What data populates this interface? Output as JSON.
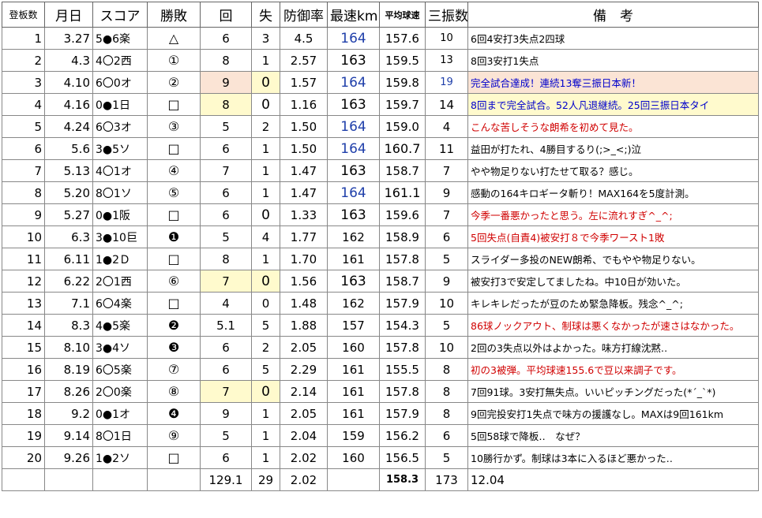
{
  "header": {
    "order": "登板数",
    "date": "月日",
    "score": "スコア",
    "result": "勝敗",
    "innings": "回",
    "runs": "失",
    "era": "防御率",
    "max_speed": "最速km",
    "avg_speed": "平均球速",
    "strikeouts": "三振数",
    "notes": "備　考"
  },
  "rows": [
    {
      "n": "1",
      "date": "3.27",
      "score": "5●6楽",
      "res": "△",
      "ip": "6",
      "r": "3",
      "era": "4.5",
      "max": "164",
      "avg": "157.6",
      "k": "10",
      "note": "6回4安打3失点2四球"
    },
    {
      "n": "2",
      "date": "4.3",
      "score": "4〇2西",
      "res": "①",
      "ip": "8",
      "r": "1",
      "era": "2.57",
      "max": "163",
      "avg": "159.5",
      "k": "13",
      "note": "8回3安打1失点"
    },
    {
      "n": "3",
      "date": "4.10",
      "score": "6〇0オ",
      "res": "②",
      "ip": "9",
      "r": "0",
      "era": "1.57",
      "max": "164",
      "avg": "159.8",
      "k": "19",
      "note": "完全試合達成！連続13奪三振日本新！"
    },
    {
      "n": "4",
      "date": "4.16",
      "score": "0●1日",
      "res": "□",
      "ip": "8",
      "r": "0",
      "era": "1.16",
      "max": "163",
      "avg": "159.7",
      "k": "14",
      "note": "8回まで完全試合。52人凡退継続。25回三振日本タイ"
    },
    {
      "n": "5",
      "date": "4.24",
      "score": "6〇3オ",
      "res": "③",
      "ip": "5",
      "r": "2",
      "era": "1.50",
      "max": "164",
      "avg": "159.0",
      "k": "4",
      "note": "こんな苦しそうな朗希を初めて見た。"
    },
    {
      "n": "6",
      "date": "5.6",
      "score": "3●5ソ",
      "res": "□",
      "ip": "6",
      "r": "1",
      "era": "1.50",
      "max": "164",
      "avg": "160.7",
      "k": "11",
      "note": "益田が打たれ、4勝目するり(;>_<;)泣"
    },
    {
      "n": "7",
      "date": "5.13",
      "score": "4〇1オ",
      "res": "④",
      "ip": "7",
      "r": "1",
      "era": "1.47",
      "max": "163",
      "avg": "158.7",
      "k": "7",
      "note": "やや物足りない打たせて取る？感じ。"
    },
    {
      "n": "8",
      "date": "5.20",
      "score": "8〇1ソ",
      "res": "⑤",
      "ip": "6",
      "r": "1",
      "era": "1.47",
      "max": "164",
      "avg": "161.1",
      "k": "9",
      "note": "感動の164キロギータ斬り！MAX164を5度計測。"
    },
    {
      "n": "9",
      "date": "5.27",
      "score": "0●1阪",
      "res": "□",
      "ip": "6",
      "r": "0",
      "era": "1.33",
      "max": "163",
      "avg": "159.6",
      "k": "7",
      "note": "今季一番悪かったと思う。左に流れすぎ^_^;"
    },
    {
      "n": "10",
      "date": "6.3",
      "score": "3●10巨",
      "res": "❶",
      "ip": "5",
      "r": "4",
      "era": "1.77",
      "max": "162",
      "avg": "158.9",
      "k": "6",
      "note": "5回失点(自責4)被安打８で今季ワースト1敗"
    },
    {
      "n": "11",
      "date": "6.11",
      "score": "1●2Ｄ",
      "res": "□",
      "ip": "8",
      "r": "1",
      "era": "1.70",
      "max": "161",
      "avg": "157.8",
      "k": "5",
      "note": "スライダー多投のNEW朗希、でもやや物足りない。"
    },
    {
      "n": "12",
      "date": "6.22",
      "score": "2〇1西",
      "res": "⑥",
      "ip": "7",
      "r": "0",
      "era": "1.56",
      "max": "163",
      "avg": "158.7",
      "k": "9",
      "note": "被安打3で安定してましたね。中10日が効いた。"
    },
    {
      "n": "13",
      "date": "7.1",
      "score": "6〇4楽",
      "res": "□",
      "ip": "4",
      "r": "0",
      "era": "1.48",
      "max": "162",
      "avg": "157.9",
      "k": "10",
      "note": "キレキレだったが豆のため緊急降板。残念^_^;"
    },
    {
      "n": "14",
      "date": "8.3",
      "score": "4●5楽",
      "res": "❷",
      "ip": "5.1",
      "r": "5",
      "era": "1.88",
      "max": "157",
      "avg": "154.3",
      "k": "5",
      "note": "86球ノックアウト、制球は悪くなかったが速さはなかった。"
    },
    {
      "n": "15",
      "date": "8.10",
      "score": "3●4ソ",
      "res": "❸",
      "ip": "6",
      "r": "2",
      "era": "2.05",
      "max": "160",
      "avg": "157.8",
      "k": "10",
      "note": "2回の3失点以外はよかった。味方打線沈黙‥"
    },
    {
      "n": "16",
      "date": "8.19",
      "score": "6〇5楽",
      "res": "⑦",
      "ip": "6",
      "r": "5",
      "era": "2.29",
      "max": "161",
      "avg": "155.5",
      "k": "8",
      "note": "初の3被弾。平均球速155.6で豆以来調子です。"
    },
    {
      "n": "17",
      "date": "8.26",
      "score": "2〇0楽",
      "res": "⑧",
      "ip": "7",
      "r": "0",
      "era": "2.14",
      "max": "161",
      "avg": "157.8",
      "k": "8",
      "note": "7回91球。3安打無失点。いいピッチングだった(*´_`*)"
    },
    {
      "n": "18",
      "date": "9.2",
      "score": "0●1オ",
      "res": "❹",
      "ip": "9",
      "r": "1",
      "era": "2.05",
      "max": "161",
      "avg": "157.9",
      "k": "8",
      "note": "9回完投安打1失点で味方の援護なし。MAXは9回161km"
    },
    {
      "n": "19",
      "date": "9.14",
      "score": "8〇1日",
      "res": "⑨",
      "ip": "5",
      "r": "1",
      "era": "2.04",
      "max": "159",
      "avg": "156.2",
      "k": "6",
      "note": "5回58球で降板‥　なぜ？"
    },
    {
      "n": "20",
      "date": "9.26",
      "score": "1●2ソ",
      "res": "□",
      "ip": "6",
      "r": "1",
      "era": "2.02",
      "max": "160",
      "avg": "156.5",
      "k": "5",
      "note": "10勝行かず。制球は3本に入るほど悪かった‥"
    }
  ],
  "totals": {
    "ip": "129.1",
    "r": "29",
    "era": "2.02",
    "avg": "158.3",
    "k": "173",
    "note": "12.04"
  },
  "colors": {
    "blue_speed": "#1f3faa",
    "red_note": "#d00000",
    "blue_note": "#0000cc",
    "peach_highlight": "#fbe4d5",
    "yellow_highlight": "#fffacd"
  }
}
